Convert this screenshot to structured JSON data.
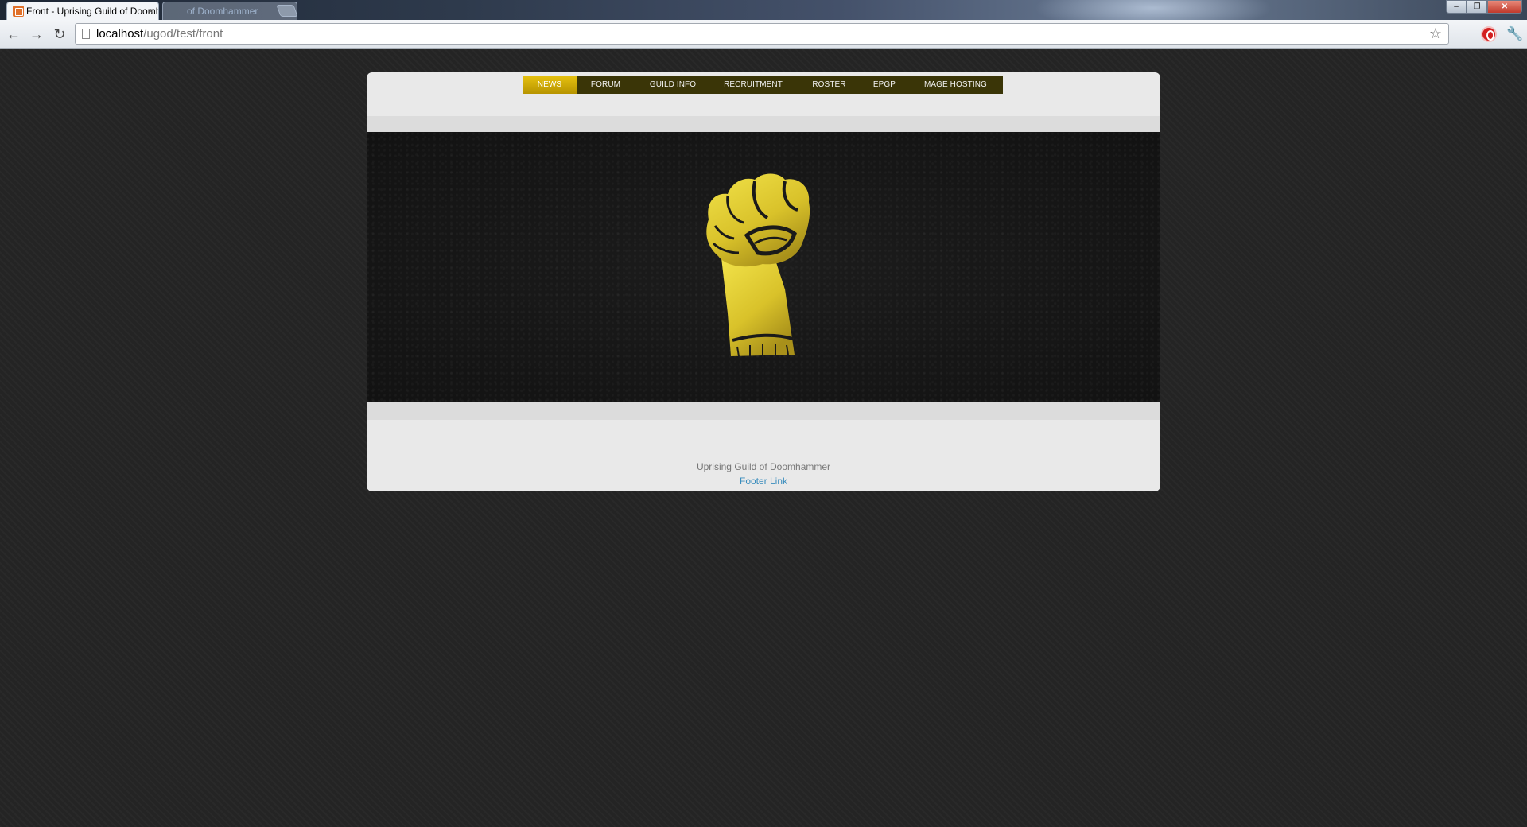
{
  "browser": {
    "active_tab_title": "Front - Uprising Guild of Doomhammer",
    "inactive_tab_title": "of Doomhammer",
    "tab_close_glyph": "×",
    "url_host": "localhost",
    "url_path": "/ugod/test/front",
    "window_controls": [
      "–",
      "❐",
      "✕"
    ],
    "nav_icons": [
      "back-arrow-icon",
      "forward-arrow-icon",
      "reload-icon"
    ]
  },
  "site": {
    "nav": {
      "items": [
        "NEWS",
        "FORUM",
        "GUILD INFO",
        "RECRUITMENT",
        "ROSTER",
        "EPGP",
        "IMAGE HOSTING"
      ],
      "active_index": 0
    },
    "footer": {
      "title": "Uprising Guild of Doomhammer",
      "link": "Footer Link"
    }
  },
  "colors": {
    "accent": "#d4b60a",
    "nav_bg": "#3a3507",
    "page_bg": "#242424",
    "card_bg": "#e9e9e9",
    "link": "#3a8dbd"
  }
}
